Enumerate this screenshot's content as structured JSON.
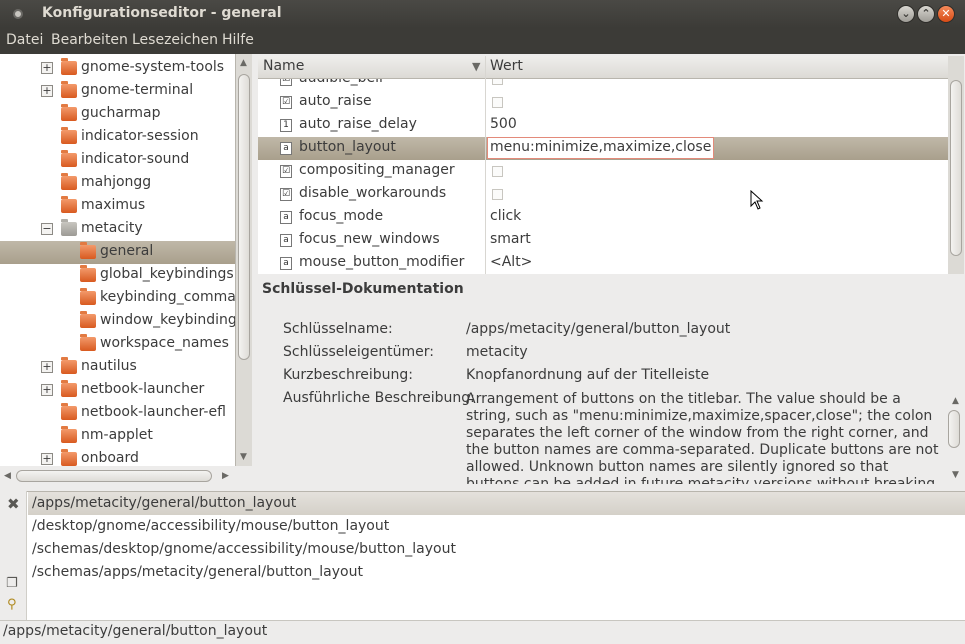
{
  "window": {
    "title": "Konfigurationseditor - general"
  },
  "menubar": {
    "items": [
      "Datei",
      "Bearbeiten",
      "Lesezeichen",
      "Hilfe"
    ]
  },
  "tree": {
    "items": [
      {
        "label": "gnome-system-tools",
        "expander": "+",
        "level": 1
      },
      {
        "label": "gnome-terminal",
        "expander": "+",
        "level": 1
      },
      {
        "label": "gucharmap",
        "expander": "",
        "level": 1
      },
      {
        "label": "indicator-session",
        "expander": "",
        "level": 1
      },
      {
        "label": "indicator-sound",
        "expander": "",
        "level": 1
      },
      {
        "label": "mahjongg",
        "expander": "",
        "level": 1
      },
      {
        "label": "maximus",
        "expander": "",
        "level": 1
      },
      {
        "label": "metacity",
        "expander": "−",
        "level": 1
      },
      {
        "label": "general",
        "expander": "",
        "level": 2
      },
      {
        "label": "global_keybindings",
        "expander": "",
        "level": 2
      },
      {
        "label": "keybinding_commar",
        "expander": "",
        "level": 2
      },
      {
        "label": "window_keybindings",
        "expander": "",
        "level": 2
      },
      {
        "label": "workspace_names",
        "expander": "",
        "level": 2
      },
      {
        "label": "nautilus",
        "expander": "+",
        "level": 1
      },
      {
        "label": "netbook-launcher",
        "expander": "+",
        "level": 1
      },
      {
        "label": "netbook-launcher-efl",
        "expander": "",
        "level": 1
      },
      {
        "label": "nm-applet",
        "expander": "",
        "level": 1
      },
      {
        "label": "onboard",
        "expander": "+",
        "level": 1
      }
    ],
    "selected": "general"
  },
  "keylist": {
    "columns": {
      "name": "Name",
      "value": "Wert"
    },
    "rows": [
      {
        "name": "audible_bell",
        "value": "",
        "type": "bool",
        "icon": "☑"
      },
      {
        "name": "auto_raise",
        "value": "",
        "type": "bool",
        "icon": "☑"
      },
      {
        "name": "auto_raise_delay",
        "value": "500",
        "type": "int",
        "icon": "1"
      },
      {
        "name": "button_layout",
        "value": "menu:minimize,maximize,close",
        "type": "string",
        "icon": "a"
      },
      {
        "name": "compositing_manager",
        "value": "",
        "type": "bool",
        "icon": "☑"
      },
      {
        "name": "disable_workarounds",
        "value": "",
        "type": "bool",
        "icon": "☑"
      },
      {
        "name": "focus_mode",
        "value": "click",
        "type": "string",
        "icon": "a"
      },
      {
        "name": "focus_new_windows",
        "value": "smart",
        "type": "string",
        "icon": "a"
      },
      {
        "name": "mouse_button_modifier",
        "value": "<Alt>",
        "type": "string",
        "icon": "a"
      }
    ],
    "selected": "button_layout"
  },
  "doc": {
    "title": "Schlüssel-Dokumentation",
    "key_name_label": "Schlüsselname:",
    "key_name": "/apps/metacity/general/button_layout",
    "owner_label": "Schlüsseleigentümer:",
    "owner": "metacity",
    "short_label": "Kurzbeschreibung:",
    "short": "Knopfanordnung auf der Titelleiste",
    "long_label": "Ausführliche Beschreibung:",
    "long": "Arrangement of buttons on the titlebar. The value should be a string, such as \"menu:minimize,maximize,spacer,close\"; the colon separates the left corner of the window from the right corner, and the button names are comma-separated. Duplicate buttons are not allowed. Unknown button names are silently ignored so that buttons can be added in future metacity versions without breaking older versions. A"
  },
  "results": {
    "items": [
      "/apps/metacity/general/button_layout",
      "/desktop/gnome/accessibility/mouse/button_layout",
      "/schemas/desktop/gnome/accessibility/mouse/button_layout",
      "/schemas/apps/metacity/general/button_layout"
    ]
  },
  "status": {
    "text": "/apps/metacity/general/button_layout"
  },
  "colors": {
    "selection": "#a99f8c",
    "titlebar": "#3c3b37",
    "close_button": "#d74b15"
  }
}
